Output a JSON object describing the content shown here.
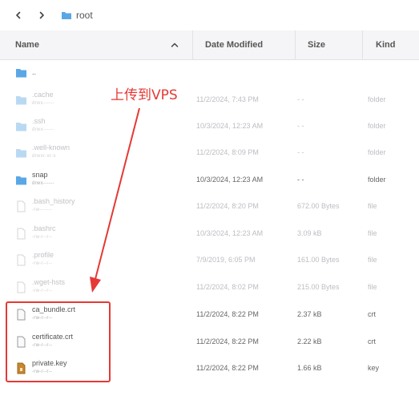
{
  "toolbar": {
    "back_icon": "chevron-left-icon",
    "forward_icon": "chevron-right-icon",
    "breadcrumb": "root"
  },
  "columns": {
    "name": "Name",
    "date": "Date Modified",
    "size": "Size",
    "kind": "Kind"
  },
  "files": [
    {
      "name": "..",
      "perm": "",
      "date": "",
      "size": "",
      "kind": "",
      "type": "folder-blue"
    },
    {
      "name": ".cache",
      "perm": "drwx------",
      "date": "11/2/2024, 7:43 PM",
      "size": "- -",
      "kind": "folder",
      "type": "folder"
    },
    {
      "name": ".ssh",
      "perm": "drwx------",
      "date": "10/3/2024, 12:23 AM",
      "size": "- -",
      "kind": "folder",
      "type": "folder"
    },
    {
      "name": ".well-known",
      "perm": "drwxr-xr-x",
      "date": "11/2/2024, 8:09 PM",
      "size": "- -",
      "kind": "folder",
      "type": "folder"
    },
    {
      "name": "snap",
      "perm": "drwx------",
      "date": "10/3/2024, 12:23 AM",
      "size": "- -",
      "kind": "folder",
      "type": "folder-blue"
    },
    {
      "name": ".bash_history",
      "perm": "-rw-------",
      "date": "11/2/2024, 8:20 PM",
      "size": "672.00 Bytes",
      "kind": "file",
      "type": "file"
    },
    {
      "name": ".bashrc",
      "perm": "-rw-r--r--",
      "date": "10/3/2024, 12:23 AM",
      "size": "3.09 kB",
      "kind": "file",
      "type": "file"
    },
    {
      "name": ".profile",
      "perm": "-rw-r--r--",
      "date": "7/9/2019, 6:05 PM",
      "size": "161.00 Bytes",
      "kind": "file",
      "type": "file"
    },
    {
      "name": ".wget-hsts",
      "perm": "-rw-r--r--",
      "date": "11/2/2024, 8:02 PM",
      "size": "215.00 Bytes",
      "kind": "file",
      "type": "file"
    },
    {
      "name": "ca_bundle.crt",
      "perm": "-rw-r--r--",
      "date": "11/2/2024, 8:22 PM",
      "size": "2.37 kB",
      "kind": "crt",
      "type": "file-dark"
    },
    {
      "name": "certificate.crt",
      "perm": "-rw-r--r--",
      "date": "11/2/2024, 8:22 PM",
      "size": "2.22 kB",
      "kind": "crt",
      "type": "file-dark"
    },
    {
      "name": "private.key",
      "perm": "-rw-r--r--",
      "date": "11/2/2024, 8:22 PM",
      "size": "1.66 kB",
      "kind": "key",
      "type": "key-file"
    }
  ],
  "annotation": {
    "text": "上传到VPS",
    "color": "#e53935"
  },
  "colors": {
    "folder_blue": "#5aa7e6",
    "folder_faded": "#b9d9f3",
    "header_bg": "#f5f5f7"
  }
}
